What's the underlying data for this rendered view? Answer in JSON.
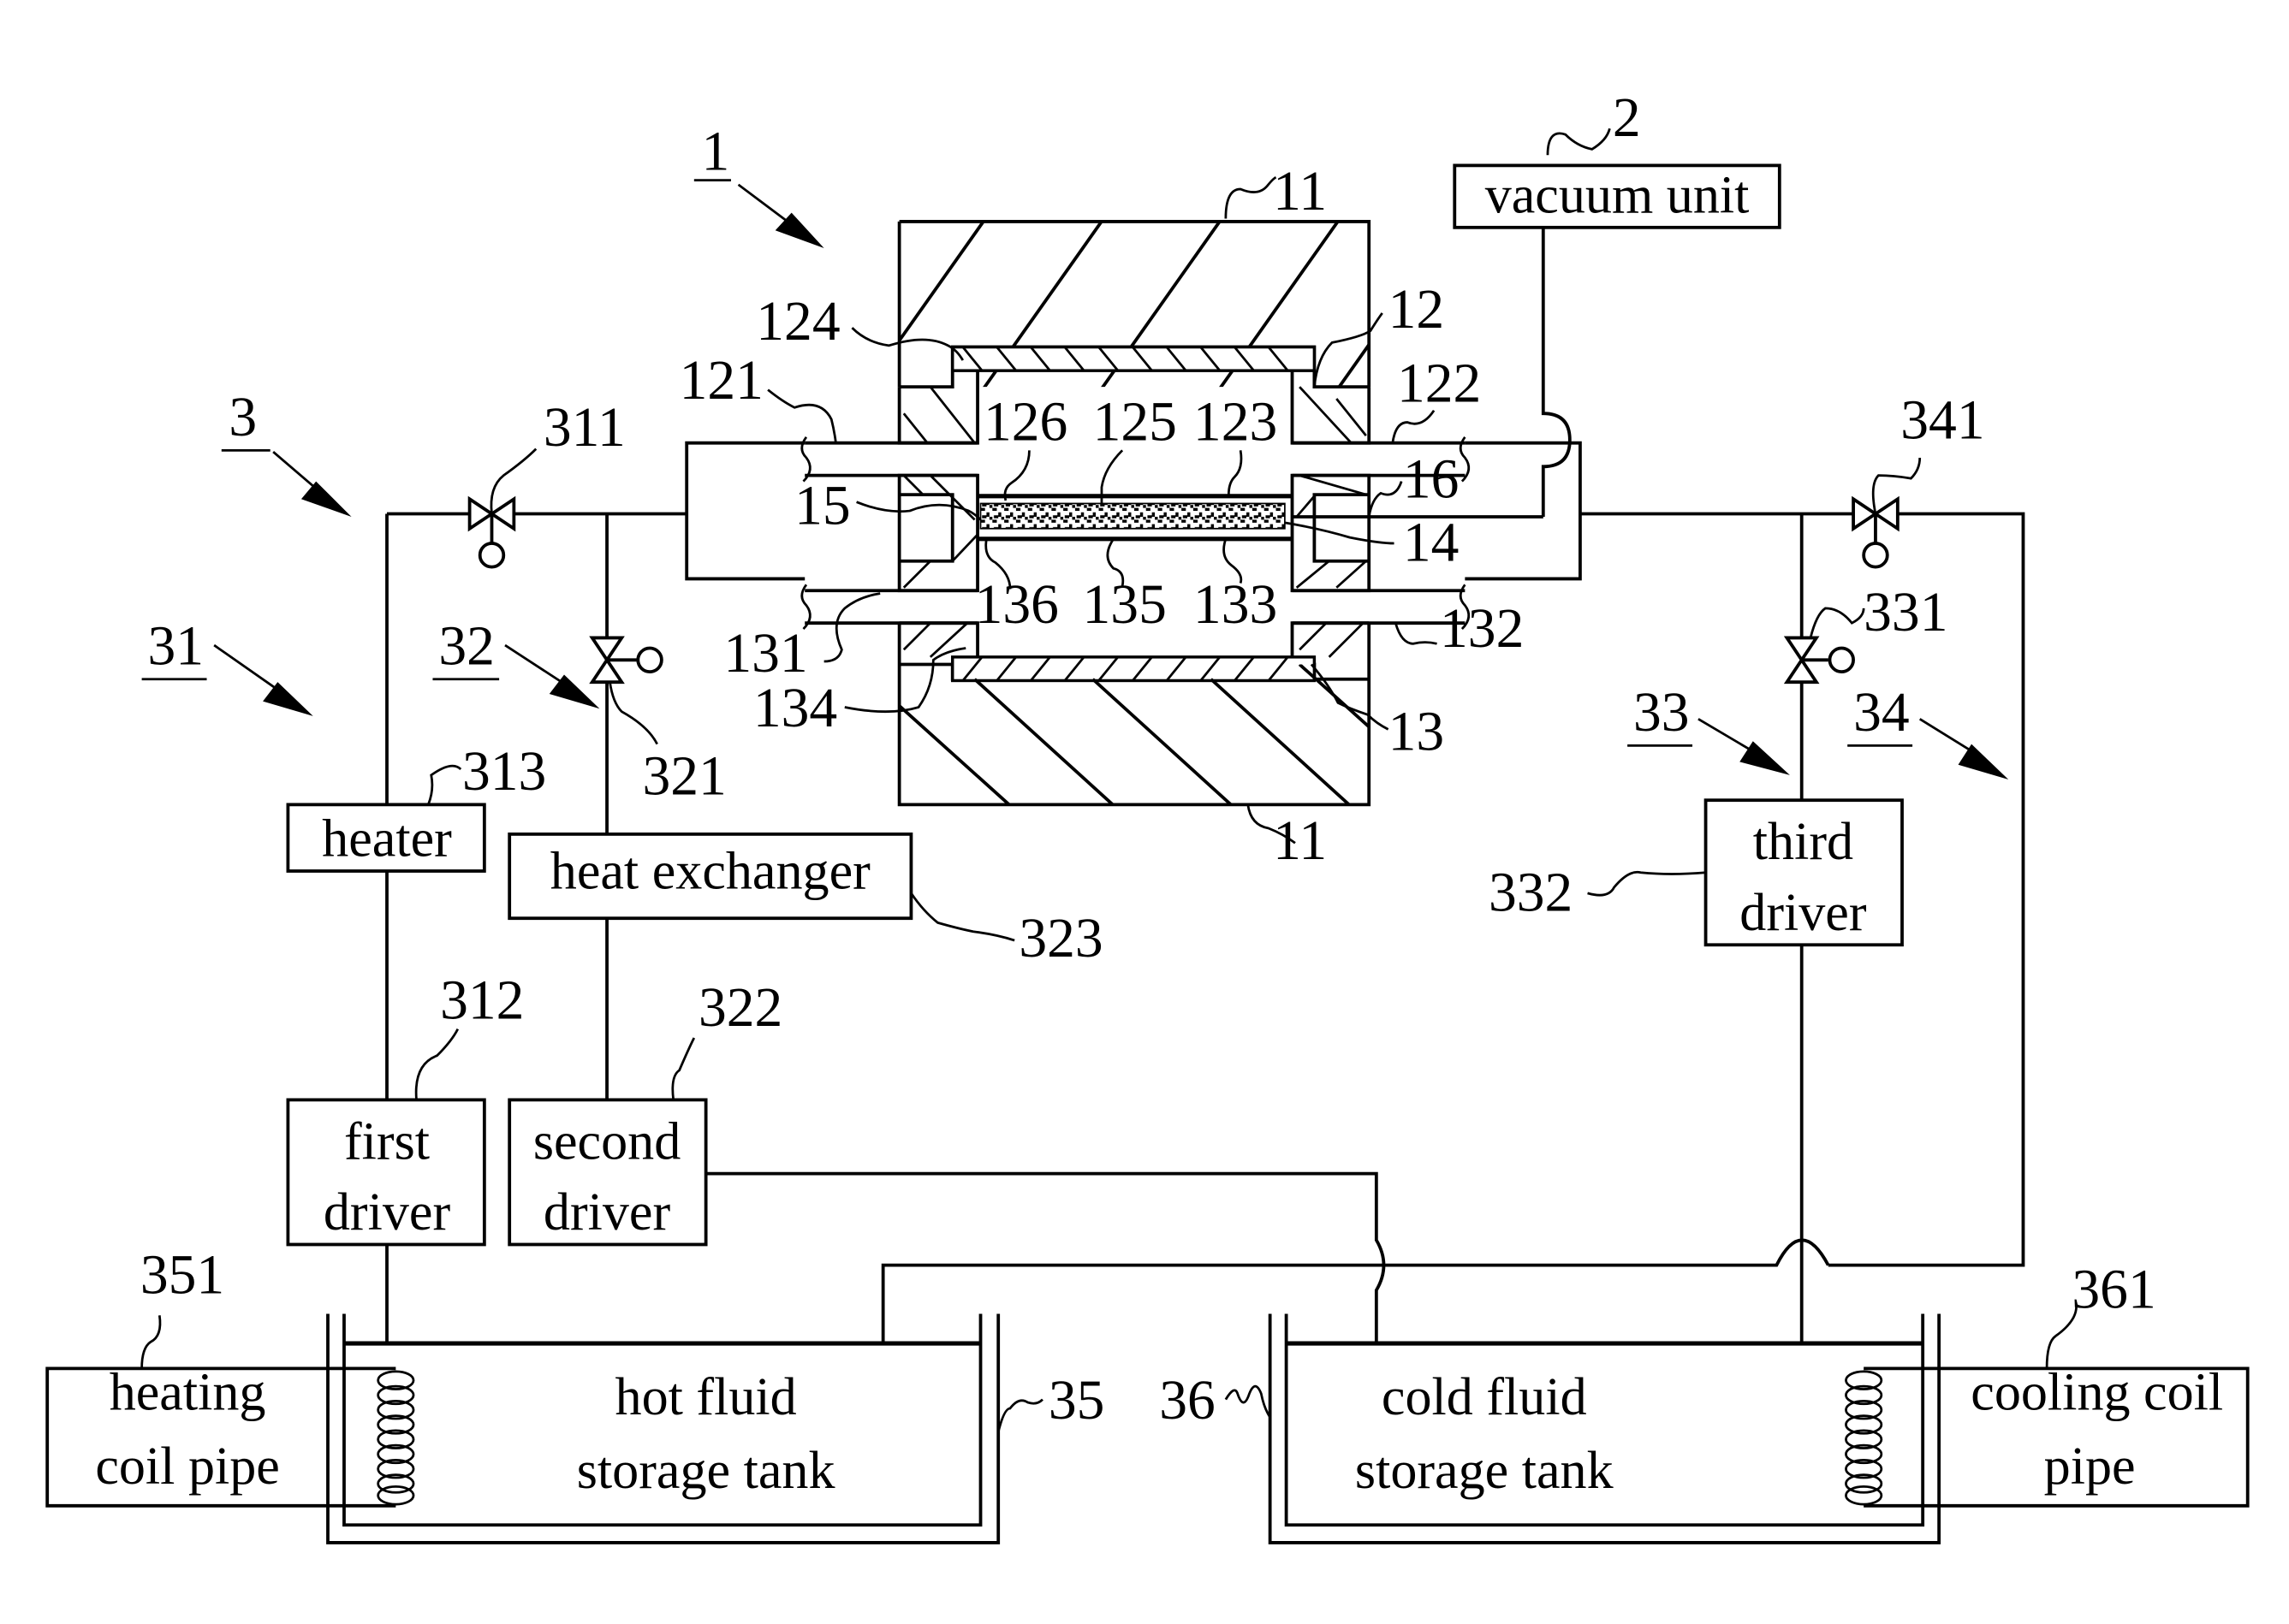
{
  "figure": {
    "assemblies": {
      "apparatus": "1",
      "vacuum": "2",
      "circulation_system": "3",
      "first_loop": "31",
      "second_loop": "32",
      "third_loop": "33",
      "fourth_loop": "34"
    },
    "components": {
      "vacuum_unit": "vacuum unit",
      "heater": "heater",
      "heat_exchanger": "heat exchanger",
      "first_driver": [
        "first",
        "driver"
      ],
      "second_driver": [
        "second",
        "driver"
      ],
      "third_driver": [
        "third",
        "driver"
      ],
      "hot_tank": [
        "hot fluid",
        "storage tank"
      ],
      "cold_tank": [
        "cold fluid",
        "storage tank"
      ],
      "heating_coil": [
        "heating",
        "coil pipe"
      ],
      "cooling_coil": [
        "cooling coil",
        "pipe"
      ]
    },
    "refs": {
      "r11_top": "11",
      "r11_bottom": "11",
      "r12": "12",
      "r13": "13",
      "r14": "14",
      "r15": "15",
      "r16": "16",
      "r121": "121",
      "r122": "122",
      "r123": "123",
      "r124": "124",
      "r125": "125",
      "r126": "126",
      "r131": "131",
      "r132": "132",
      "r133": "133",
      "r134": "134",
      "r135": "135",
      "r136": "136",
      "r311": "311",
      "r312": "312",
      "r313": "313",
      "r321": "321",
      "r322": "322",
      "r323": "323",
      "r331": "331",
      "r332": "332",
      "r341": "341",
      "r35": "35",
      "r36": "36",
      "r351": "351",
      "r361": "361"
    }
  }
}
